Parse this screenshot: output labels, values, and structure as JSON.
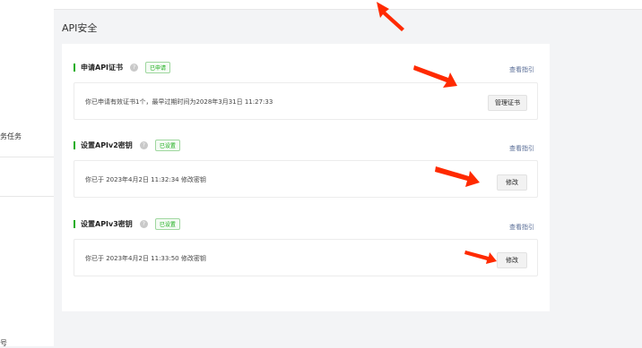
{
  "nav": {
    "task_label": "务任务",
    "bottom_label": "号"
  },
  "page_title": "API安全",
  "sections": [
    {
      "title": "申请API证书",
      "badge": "已申请",
      "help_icon": "?",
      "guide_link": "查看指引",
      "message": "你已申请有效证书1个，最早过期时间为2028年3月31日 11:27:33",
      "button": "管理证书"
    },
    {
      "title": "设置APIv2密钥",
      "badge": "已设置",
      "help_icon": "?",
      "guide_link": "查看指引",
      "message": "你已于 2023年4月2日 11:32:34 修改密钥",
      "button": "修改"
    },
    {
      "title": "设置APIv3密钥",
      "badge": "已设置",
      "help_icon": "?",
      "guide_link": "查看指引",
      "message": "你已于 2023年4月2日 11:33:50 修改密钥",
      "button": "修改"
    }
  ],
  "colors": {
    "accent": "#1aad19",
    "link": "#576b95",
    "annotation_arrow": "#ff2a00"
  }
}
